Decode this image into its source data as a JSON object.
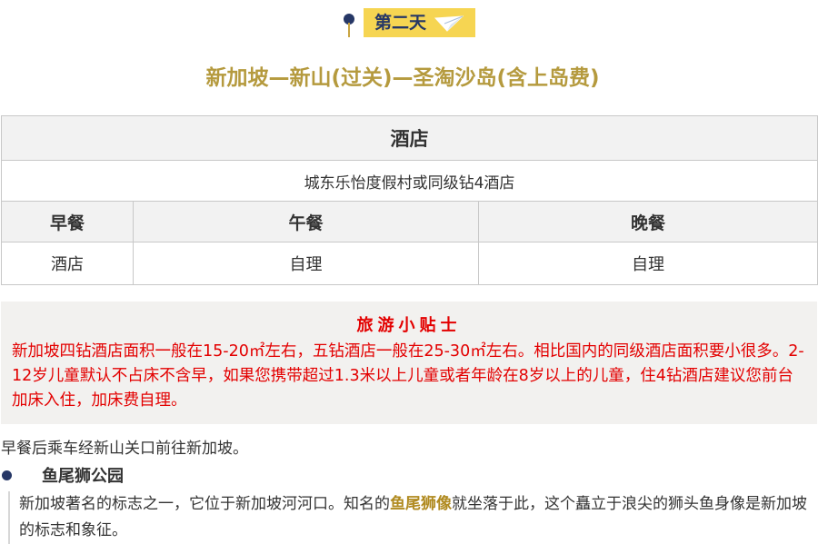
{
  "day": {
    "label": "第二天",
    "icon": "paper-plane-icon"
  },
  "route_title": "新加坡—新山(过关)—圣淘沙岛(含上岛费)",
  "hotel": {
    "header": "酒店",
    "name": "城东乐怡度假村或同级钻4酒店"
  },
  "meals": {
    "headers": [
      "早餐",
      "午餐",
      "晚餐"
    ],
    "values": [
      "酒店",
      "自理",
      "自理"
    ]
  },
  "tips": {
    "title": "旅游小贴士",
    "text": "新加坡四钻酒店面积一般在15-20㎡左右，五钻酒店一般在25-30㎡左右。相比国内的同级酒店面积要小很多。2-12岁儿童默认不占床不含早，如果您携带超过1.3米以上儿童或者年龄在8岁以上的儿童，住4钻酒店建议您前台加床入住，加床费自理。"
  },
  "intro": "早餐后乘车经新山关口前往新加坡。",
  "attraction": {
    "title": "鱼尾狮公园",
    "desc_before": "新加坡著名的标志之一，它位于新加坡河河口。知名的",
    "highlight": "鱼尾狮像",
    "desc_after": "就坐落于此，这个矗立于浪尖的狮头鱼身像是新加坡的标志和象征。"
  },
  "colors": {
    "navy": "#263766",
    "gold": "#b59a3e",
    "badge": "#f6d552",
    "tips_red": "#e30000"
  }
}
